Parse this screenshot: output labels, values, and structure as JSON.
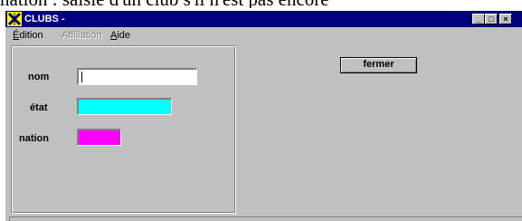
{
  "page_caption": "nation : saisie d'un club s'il n'est pas encore",
  "window": {
    "title": "CLUBS -",
    "minimize_glyph": "_",
    "maximize_glyph": "□",
    "close_glyph": "×",
    "app_icon": "clubs-app-icon"
  },
  "menu": [
    {
      "label": "Édition",
      "enabled": true
    },
    {
      "label": "Affiliation",
      "enabled": false
    },
    {
      "label": "Aide",
      "enabled": true
    }
  ],
  "form": {
    "nom_label": "nom",
    "nom_value": "",
    "etat_label": "état",
    "etat_color": "#00ffff",
    "nation_label": "nation",
    "nation_color": "#ff00ff"
  },
  "buttons": {
    "close_label": "fermer"
  },
  "status": {
    "text": ""
  }
}
